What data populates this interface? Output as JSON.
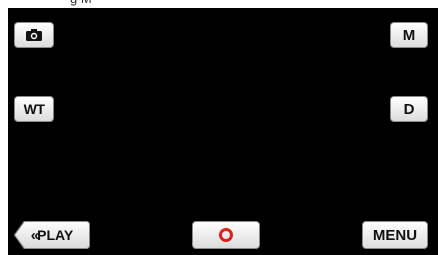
{
  "header_clip": {
    "text": "g               M"
  },
  "buttons": {
    "camera": {
      "icon": "camera-icon"
    },
    "manual": {
      "label": "M"
    },
    "zoom": {
      "label": "WT"
    },
    "display": {
      "label": "D"
    },
    "play": {
      "chevron": "«",
      "label": "PLAY"
    },
    "record": {
      "icon": "record-icon",
      "color": "#e0201b"
    },
    "menu": {
      "label": "MENU"
    }
  }
}
